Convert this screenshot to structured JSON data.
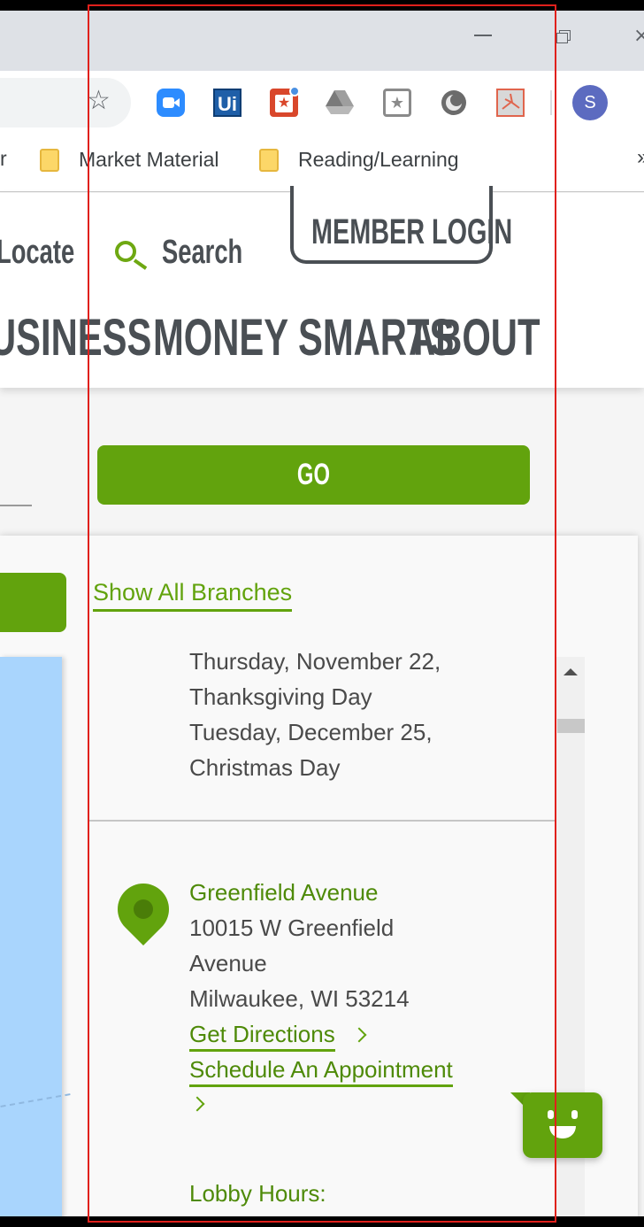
{
  "browser": {
    "window_controls": {
      "minimize_icon": "minimize-icon",
      "restore_icon": "restore-icon",
      "close_glyph": "×"
    },
    "bookmark_star_glyph": "☆",
    "extensions": [
      "zoom-icon",
      "uipath-icon",
      "red-extension-icon",
      "google-drive-icon",
      "pocket-icon",
      "circle-extension-icon",
      "pdf-icon"
    ],
    "uipath_label": "Ui",
    "profile_initial": "S",
    "bookmarks": {
      "cut_item_tail": "r",
      "items": [
        {
          "label": "Market Material"
        },
        {
          "label": "Reading/Learning"
        }
      ],
      "overflow_glyph": "»"
    }
  },
  "site": {
    "header": {
      "locate_label": "Locate",
      "search_label": "Search",
      "member_login_label": "MEMBER LOGIN",
      "nav": {
        "business": "USINESS",
        "money_smarts": "MONEY SMARTS",
        "about": "ABOUT"
      }
    },
    "search": {
      "go_label": "GO"
    },
    "panel": {
      "show_all_label": "Show All Branches",
      "holidays": [
        "Thursday, November 22,",
        "Thanksgiving Day",
        "Tuesday, December 25,",
        "Christmas Day"
      ],
      "branch": {
        "name": "Greenfield Avenue",
        "address_lines": [
          "10015 W Greenfield",
          "Avenue",
          "Milwaukee, WI 53214"
        ],
        "directions_label": "Get Directions",
        "appointment_label": "Schedule An Appointment",
        "lobby_hours_label": "Lobby Hours:"
      }
    }
  },
  "colors": {
    "brand_green": "#62a30d",
    "link_green": "#4e8a08",
    "nav_gray": "#4a4f54",
    "annotation_red": "#e0201c",
    "map_blue": "#a9d5fd"
  }
}
